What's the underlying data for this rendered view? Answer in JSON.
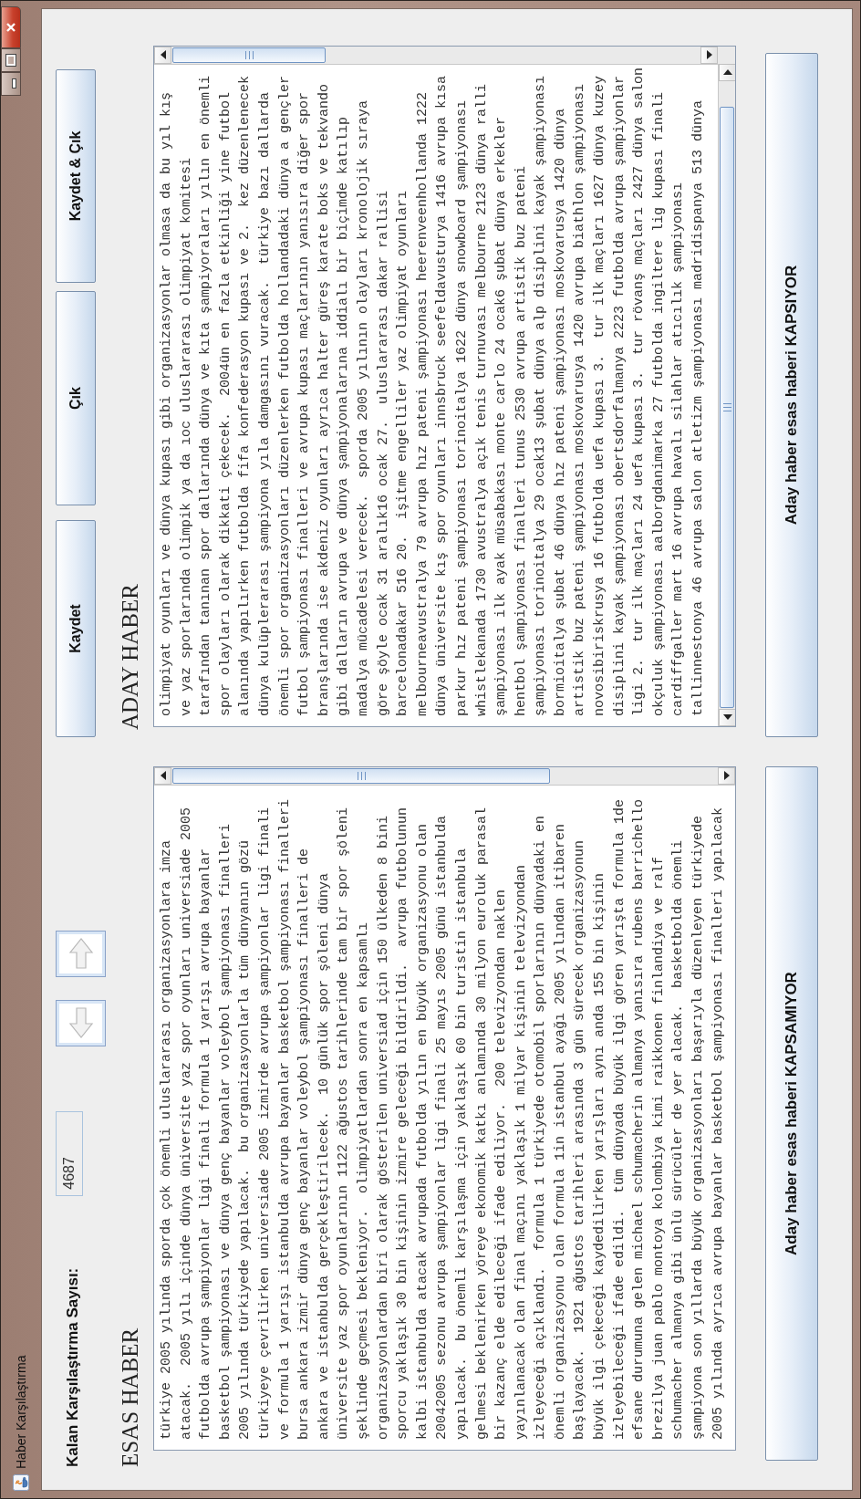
{
  "window": {
    "title": "Haber Karşılaştırma"
  },
  "counter": {
    "label": "Kalan Karşılaştırma Sayısı:",
    "value": "4687"
  },
  "toolbar_buttons": [
    "Kaydet",
    "Çık",
    "Kaydet & Çık"
  ],
  "panels": [
    {
      "heading": "ESAS HABER",
      "lines": [
        "türkiye 2005 yılında sporda çok önemli uluslararası organizasyonlara imza",
        "atacak.  2005 yılı içinde dünya üniversite yaz spor oyunları universiade 2005",
        "futbolda avrupa şampiyonlar ligi finali formula 1 yarışı avrupa bayanlar",
        "basketbol şampiyonası ve dünya genç bayanlar voleybol şampiyonası finalleri",
        "2005 yılında türkiyede yapılacak.  bu organizasyonlarla tüm dünyanın gözü",
        "türkiyeye çevrilirken universiade 2005 izmirde avrupa şampiyonlar ligi finali",
        "ve formula 1 yarışı istanbulda avrupa bayanlar basketbol şampiyonası finalleri",
        "bursa ankara izmir dünya genç bayanlar voleybol şampiyonası finalleri de",
        "ankara ve istanbulda gerçekleştirilecek.  10 günlük spor şöleni dünya",
        "üniversite yaz spor oyunlarının 1122 ağustos tarihlerinde tam bir spor şöleni",
        "şeklinde geçmesi bekleniyor.  olimpiyatlardan sonra en kapsamlı",
        "organizasyonlardan biri olarak gösterilen universiad için 150 ülkeden 8 bini",
        "sporcu yaklaşık 30 bin kişinin izmire geleceği bildirildi.  avrupa futbolunun",
        "kalbi istanbulda atacak avrupada futbolda yılın en büyük organizasyonu olan",
        "20042005 sezonu avrupa şampiyonlar ligi finali 25 mayıs 2005 günü istanbulda",
        "yapılacak.  bu önemli karşılaşma için yaklaşık 60 bin turistin istanbula",
        "gelmesi beklenirken yöreye ekonomik katkı anlamında 30 milyon euroluk parasal",
        "bir kazanç elde edileceği ifade ediliyor.  200 televizyondan naklen",
        "yayınlanacak olan final maçını yaklaşık 1 milyar kişinin televizyondan",
        "izleyeceği açıklandı.  formula 1 türkiyede otomobil sporlarının dünyadaki en",
        "önemli organizasyonu olan formula 1in istanbul ayağı 2005 yılından itibaren",
        "başlayacak.  1921 ağustos tarihleri arasında 3 gün sürecek organizasyonun",
        "büyük ilgi çekeceği kaydedilirken yarışları aynı anda 155 bin kişinin",
        "izleyebileceği ifade edildi.  tüm dünyada büyük ilgi gören yarışta formula 1de",
        "efsane durumuna gelen michael schumacherin almanya yanısıra rubens barrichello",
        "brezilya juan pablo montoya kolombiya kimi raikkonen finlandiya ve ralf",
        "schumacher almanya gibi ünlü sürücüler de yer alacak.  basketbolda önemli",
        "şampiyona son yıllarda büyük organizasyonları başarıyla düzenleyen türkiyede",
        "2005 yılında ayrıca avrupa bayanlar basketbol şampiyonası finalleri yapılacak"
      ]
    },
    {
      "heading": "ADAY HABER",
      "lines": [
        "olimpiyat oyunları ve dünya kupası gibi organizasyonlar olmasa da bu yıl kış",
        "ve yaz sporlarında olimpik ya da ıoc uluslararası olimpiyat komitesi",
        "tarafından tanınan spor dallarında dünya ve kıta şampiyoraları yılın en önemli",
        "spor olayları olarak dikkati çekecek.  2004ün en fazla etkinliği yine futbol",
        "alanında yapılırken futbolda fifa konfederasyon kupası ve 2.  kez düzenlenecek",
        "dünya kulüplerarası şampiyona yıla damgasını vuracak.  türkiye bazı dallarda",
        "önemli spor organizasyonları düzenlerken futbolda hollandadaki dünya a gençler",
        "futbol şampiyonası finalleri ve avrupa kupası maçlarının yanısıra diğer spor",
        "branşlarında ise akdeniz oyunları ayrıca halter güreş karate boks ve tekvando",
        "gibi dalların avrupa ve dünya şampiyonalarına iddialı bir biçimde katılıp",
        "madalya mücadelesi verecek.  sporda 2005 yılının olayları kronolojik sıraya",
        "göre şöyle ocak 31 aralık16 ocak 27.  uluslararası dakar rallisi",
        "barcelonadakar 516 20.  işitme engelliler yaz olimpiyat oyunları",
        "melbourneavustralya 79 avrupa hız pateni şampiyonası heerenveenhollanda 1222",
        "dünya üniversite kış spor oyunları innsbruck seefeldavusturya 1416 avrupa kısa",
        "parkur hız pateni şampiyonası torinoitalya 1622 dünya snowboard şampiyonası",
        "whistlekanada 1730 avustralya açık tenis turnuvası melbourne 2123 dünya ralli",
        "şampiyonası ilk ayak müsabakası monte carlo 24 ocak6 şubat dünya erkekler",
        "hentbol şampiyonası finalleri tunus 2530 avrupa artistik buz pateni",
        "şampiyonası torinoitalya 29 ocak13 şubat dünya alp disiplini kayak şampiyonası",
        "bormioitalya şubat 46 dünya hız pateni şampiyonası moskovarusya 1420 dünya",
        "artistik buz pateni şampiyonası moskovarusya 1420 avrupa biathlon şampiyonası",
        "novosibiriskrusya 16 futbolda uefa kupası 3.  tur ilk maçları 1627 dünya kuzey",
        "disiplini kayak şampiyonası obertsdorfalmanya 2223 futbolda avrupa şampiyonlar",
        "ligi 2.  tur ilk maçları 24 uefa kupası 3.  tur rövanş maçları 2427 dünya salon",
        "okçuluk şampiyonası aalborgdanimarka 27 futbolda ingiltere lig kupası finali",
        "cardiffgaller mart 16 avrupa havalı silahlar atıcılık şampiyonası",
        "tallinnestonya 46 avrupa salon atletizm şampiyonası madridispanya 513 dünya"
      ]
    }
  ],
  "decision_buttons": [
    "Aday haber esas haberi KAPSAMIYOR",
    "Aday haber esas haberi KAPSIYOR"
  ]
}
